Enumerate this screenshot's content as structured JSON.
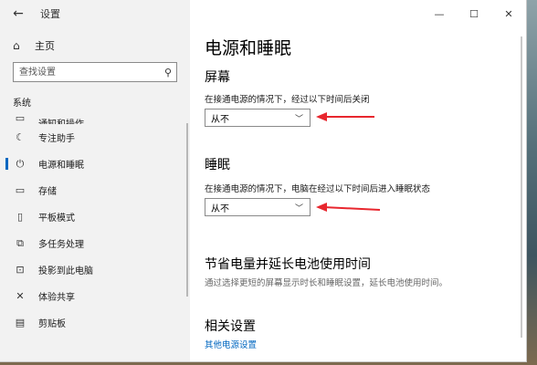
{
  "window": {
    "title": "设置"
  },
  "sidebar": {
    "home_label": "主页",
    "search_placeholder": "查找设置",
    "section": "系统",
    "items": [
      {
        "label": "通知和操作",
        "icon": "notification-icon"
      },
      {
        "label": "专注助手",
        "icon": "moon-icon"
      },
      {
        "label": "电源和睡眠",
        "icon": "power-icon",
        "active": true
      },
      {
        "label": "存储",
        "icon": "storage-icon"
      },
      {
        "label": "平板模式",
        "icon": "tablet-icon"
      },
      {
        "label": "多任务处理",
        "icon": "multitask-icon"
      },
      {
        "label": "投影到此电脑",
        "icon": "project-icon"
      },
      {
        "label": "体验共享",
        "icon": "share-icon"
      },
      {
        "label": "剪贴板",
        "icon": "clipboard-icon"
      }
    ]
  },
  "main": {
    "title": "电源和睡眠",
    "screen": {
      "heading": "屏幕",
      "desc": "在接通电源的情况下，经过以下时间后关闭",
      "value": "从不"
    },
    "sleep": {
      "heading": "睡眠",
      "desc": "在接通电源的情况下，电脑在经过以下时间后进入睡眠状态",
      "value": "从不"
    },
    "battery": {
      "heading": "节省电量并延长电池使用时间",
      "desc": "通过选择更短的屏幕显示时长和睡眠设置，延长电池使用时间。"
    },
    "related": {
      "heading": "相关设置",
      "link": "其他电源设置"
    }
  },
  "colors": {
    "accent": "#0067c0",
    "annotation_arrow": "#e8262e"
  }
}
